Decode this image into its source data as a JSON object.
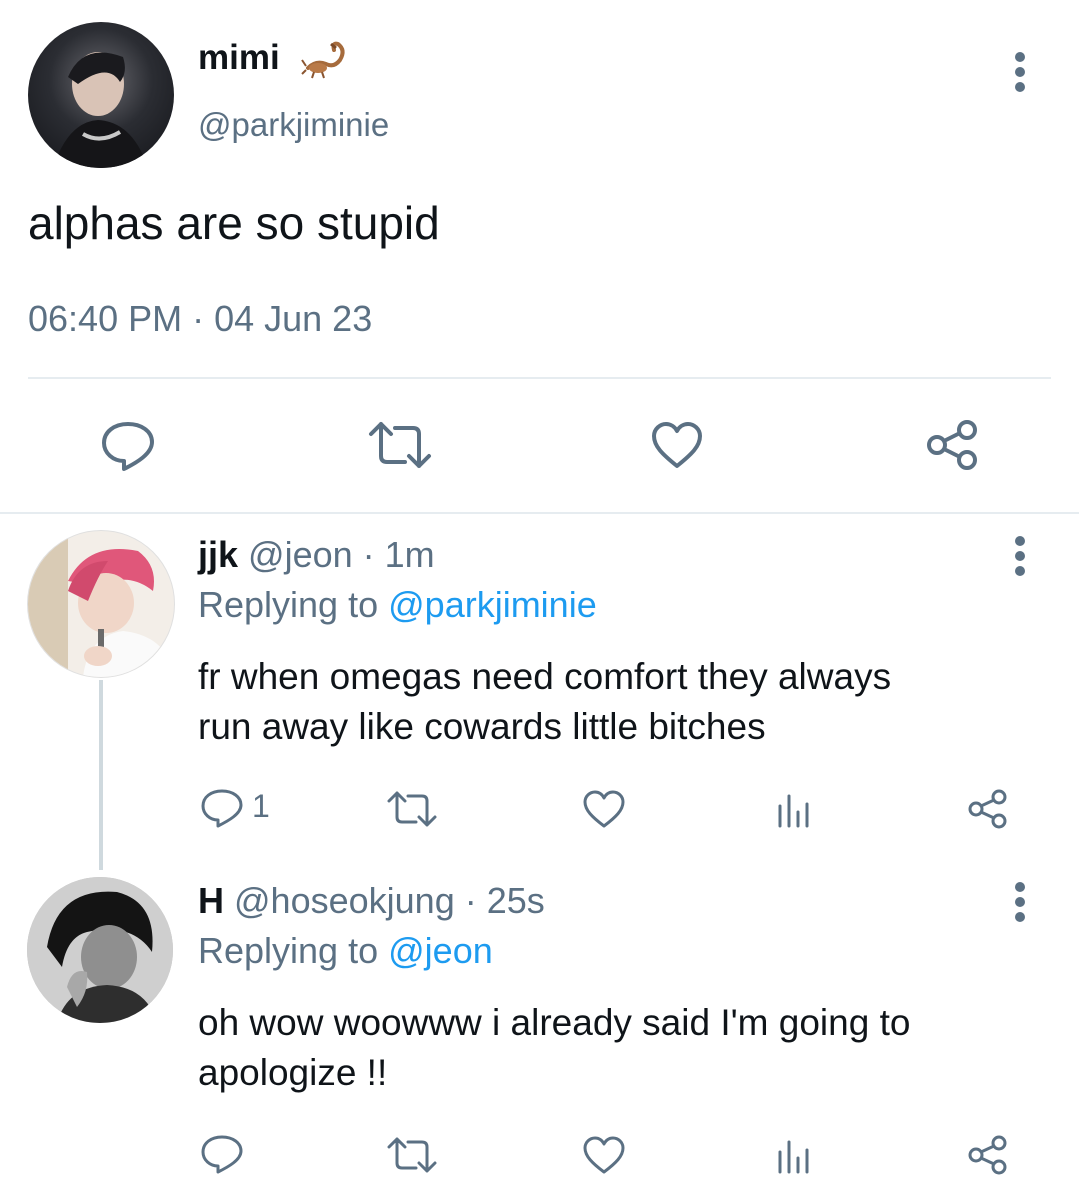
{
  "main_tweet": {
    "display_name": "mimi",
    "name_emoji_icon": "scorpion-icon",
    "handle": "@parkjiminie",
    "text": "alphas are so stupid",
    "timestamp": "06:40 PM · 04 Jun 23",
    "actions": [
      "reply-icon",
      "retweet-icon",
      "like-icon",
      "share-icon"
    ]
  },
  "replies": [
    {
      "display_name": "jjk",
      "handle": "@jeon",
      "time": "· 1m",
      "replying_label": "Replying to",
      "replying_handle": "@parkjiminie",
      "text_line1": "fr when omegas need comfort they always",
      "text_line2": "run away like cowards little bitches",
      "reply_count": "1"
    },
    {
      "display_name": "H",
      "handle": "@hoseokjung",
      "time": "· 25s",
      "replying_label": "Replying to",
      "replying_handle": "@jeon",
      "text_line1": "oh wow woowww i already said I'm going to",
      "text_line2": "apologize !!",
      "reply_count": ""
    }
  ],
  "colors": {
    "text": "#0f1419",
    "secondary": "#5b7083",
    "link": "#1d9bf0",
    "divider": "#e6ecf0"
  }
}
